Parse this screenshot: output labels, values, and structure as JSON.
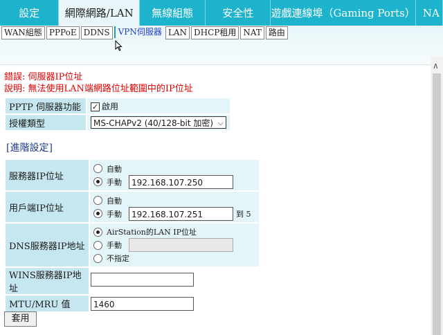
{
  "topnav": {
    "tabs": [
      {
        "label": "設定"
      },
      {
        "label": "網際網路/LAN"
      },
      {
        "label": "無線組態"
      },
      {
        "label": "安全性"
      },
      {
        "label": "遊戲連線埠（Gaming Ports）"
      },
      {
        "label": "NA"
      }
    ]
  },
  "subnav": {
    "tabs": [
      {
        "label": "WAN組態"
      },
      {
        "label": "PPPoE"
      },
      {
        "label": "DDNS"
      },
      {
        "label": "VPN伺服器"
      },
      {
        "label": "LAN"
      },
      {
        "label": "DHCP租用"
      },
      {
        "label": "NAT"
      },
      {
        "label": "路由"
      }
    ]
  },
  "error": {
    "line1": "錯誤: 伺服器IP位址",
    "line2": "說明: 無法使用LAN端網路位址範圍中的IP位址"
  },
  "pptp": {
    "label": "PPTP 伺服器功能",
    "checkbox_label": "啟用"
  },
  "auth": {
    "label": "授權類型",
    "selected": "MS-CHAPv2 (40/128-bit 加密)"
  },
  "advanced_title": "[進階設定]",
  "server_ip": {
    "label": "服務器IP位址",
    "auto": "自動",
    "manual": "手動",
    "value": "192.168.107.250"
  },
  "client_ip": {
    "label": "用戶端IP位址",
    "auto": "自動",
    "manual": "手動",
    "value": "192.168.107.251",
    "suffix": "到 5"
  },
  "dns": {
    "label": "DNS服務器IP地址",
    "opt1": "AirStation的LAN IP位址",
    "opt2": "手動",
    "opt3": "不指定",
    "value": ""
  },
  "wins": {
    "label": "WINS服務器IP地址",
    "value": ""
  },
  "mtu": {
    "label": "MTU/MRU 值",
    "value": "1460"
  },
  "apply_label": "套用",
  "colors": {
    "nav": "#1db3cc",
    "label_cell": "#c6e7ef",
    "value_cell": "#e4f5f9",
    "error": "#e00000"
  }
}
